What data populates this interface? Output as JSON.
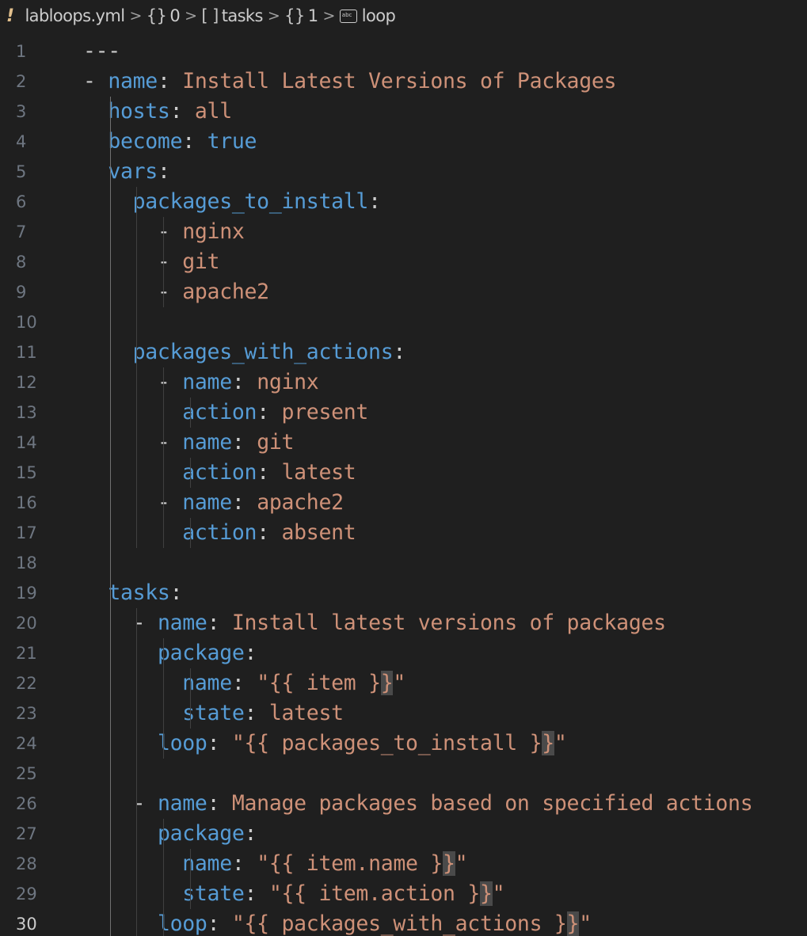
{
  "breadcrumb": {
    "warning_icon": "exclamation-icon",
    "file": "labloops.yml",
    "sep": ">",
    "segments": [
      {
        "icon": "object-icon",
        "symbol": "{}",
        "label": "0"
      },
      {
        "icon": "array-icon",
        "symbol": "[ ]",
        "label": "tasks"
      },
      {
        "icon": "object-icon",
        "symbol": "{}",
        "label": "1"
      },
      {
        "icon": "string-icon",
        "symbol": "",
        "label": "loop"
      }
    ]
  },
  "colors": {
    "background": "#1f1f1f",
    "key": "#569cd6",
    "value": "#ce9178",
    "line_number": "#6e7681"
  },
  "active_line": 30,
  "lines": [
    {
      "n": "1",
      "t": [
        {
          "c": "p",
          "s": "---"
        }
      ]
    },
    {
      "n": "2",
      "t": [
        {
          "c": "p",
          "s": "- "
        },
        {
          "c": "k",
          "s": "name"
        },
        {
          "c": "p",
          "s": ": "
        },
        {
          "c": "v",
          "s": "Install Latest Versions of Packages"
        }
      ]
    },
    {
      "n": "3",
      "t": [
        {
          "c": "p",
          "s": "  "
        },
        {
          "c": "k",
          "s": "hosts"
        },
        {
          "c": "p",
          "s": ": "
        },
        {
          "c": "v",
          "s": "all"
        }
      ]
    },
    {
      "n": "4",
      "t": [
        {
          "c": "p",
          "s": "  "
        },
        {
          "c": "k",
          "s": "become"
        },
        {
          "c": "p",
          "s": ": "
        },
        {
          "c": "k",
          "s": "true"
        }
      ]
    },
    {
      "n": "5",
      "t": [
        {
          "c": "p",
          "s": "  "
        },
        {
          "c": "k",
          "s": "vars"
        },
        {
          "c": "p",
          "s": ":"
        }
      ]
    },
    {
      "n": "6",
      "t": [
        {
          "c": "p",
          "s": "    "
        },
        {
          "c": "k",
          "s": "packages_to_install"
        },
        {
          "c": "p",
          "s": ":"
        }
      ]
    },
    {
      "n": "7",
      "t": [
        {
          "c": "p",
          "s": "      - "
        },
        {
          "c": "v",
          "s": "nginx"
        }
      ]
    },
    {
      "n": "8",
      "t": [
        {
          "c": "p",
          "s": "      - "
        },
        {
          "c": "v",
          "s": "git"
        }
      ]
    },
    {
      "n": "9",
      "t": [
        {
          "c": "p",
          "s": "      - "
        },
        {
          "c": "v",
          "s": "apache2"
        }
      ]
    },
    {
      "n": "10",
      "t": []
    },
    {
      "n": "11",
      "t": [
        {
          "c": "p",
          "s": "    "
        },
        {
          "c": "k",
          "s": "packages_with_actions"
        },
        {
          "c": "p",
          "s": ":"
        }
      ]
    },
    {
      "n": "12",
      "t": [
        {
          "c": "p",
          "s": "      - "
        },
        {
          "c": "k",
          "s": "name"
        },
        {
          "c": "p",
          "s": ": "
        },
        {
          "c": "v",
          "s": "nginx"
        }
      ]
    },
    {
      "n": "13",
      "t": [
        {
          "c": "p",
          "s": "        "
        },
        {
          "c": "k",
          "s": "action"
        },
        {
          "c": "p",
          "s": ": "
        },
        {
          "c": "v",
          "s": "present"
        }
      ]
    },
    {
      "n": "14",
      "t": [
        {
          "c": "p",
          "s": "      - "
        },
        {
          "c": "k",
          "s": "name"
        },
        {
          "c": "p",
          "s": ": "
        },
        {
          "c": "v",
          "s": "git"
        }
      ]
    },
    {
      "n": "15",
      "t": [
        {
          "c": "p",
          "s": "        "
        },
        {
          "c": "k",
          "s": "action"
        },
        {
          "c": "p",
          "s": ": "
        },
        {
          "c": "v",
          "s": "latest"
        }
      ]
    },
    {
      "n": "16",
      "t": [
        {
          "c": "p",
          "s": "      - "
        },
        {
          "c": "k",
          "s": "name"
        },
        {
          "c": "p",
          "s": ": "
        },
        {
          "c": "v",
          "s": "apache2"
        }
      ]
    },
    {
      "n": "17",
      "t": [
        {
          "c": "p",
          "s": "        "
        },
        {
          "c": "k",
          "s": "action"
        },
        {
          "c": "p",
          "s": ": "
        },
        {
          "c": "v",
          "s": "absent"
        }
      ]
    },
    {
      "n": "18",
      "t": []
    },
    {
      "n": "19",
      "t": [
        {
          "c": "p",
          "s": "  "
        },
        {
          "c": "k",
          "s": "tasks"
        },
        {
          "c": "p",
          "s": ":"
        }
      ]
    },
    {
      "n": "20",
      "t": [
        {
          "c": "p",
          "s": "    - "
        },
        {
          "c": "k",
          "s": "name"
        },
        {
          "c": "p",
          "s": ": "
        },
        {
          "c": "v",
          "s": "Install latest versions of packages"
        }
      ]
    },
    {
      "n": "21",
      "t": [
        {
          "c": "p",
          "s": "      "
        },
        {
          "c": "k",
          "s": "package"
        },
        {
          "c": "p",
          "s": ":"
        }
      ]
    },
    {
      "n": "22",
      "t": [
        {
          "c": "p",
          "s": "        "
        },
        {
          "c": "k",
          "s": "name"
        },
        {
          "c": "p",
          "s": ": "
        },
        {
          "c": "v",
          "s": "\"{{ item }"
        },
        {
          "c": "br",
          "s": "}"
        },
        {
          "c": "v",
          "s": "\""
        }
      ]
    },
    {
      "n": "23",
      "t": [
        {
          "c": "p",
          "s": "        "
        },
        {
          "c": "k",
          "s": "state"
        },
        {
          "c": "p",
          "s": ": "
        },
        {
          "c": "v",
          "s": "latest"
        }
      ]
    },
    {
      "n": "24",
      "t": [
        {
          "c": "p",
          "s": "      "
        },
        {
          "c": "k",
          "s": "loop"
        },
        {
          "c": "p",
          "s": ": "
        },
        {
          "c": "v",
          "s": "\"{{ packages_to_install }"
        },
        {
          "c": "br",
          "s": "}"
        },
        {
          "c": "v",
          "s": "\""
        }
      ]
    },
    {
      "n": "25",
      "t": []
    },
    {
      "n": "26",
      "t": [
        {
          "c": "p",
          "s": "    - "
        },
        {
          "c": "k",
          "s": "name"
        },
        {
          "c": "p",
          "s": ": "
        },
        {
          "c": "v",
          "s": "Manage packages based on specified actions"
        }
      ]
    },
    {
      "n": "27",
      "t": [
        {
          "c": "p",
          "s": "      "
        },
        {
          "c": "k",
          "s": "package"
        },
        {
          "c": "p",
          "s": ":"
        }
      ]
    },
    {
      "n": "28",
      "t": [
        {
          "c": "p",
          "s": "        "
        },
        {
          "c": "k",
          "s": "name"
        },
        {
          "c": "p",
          "s": ": "
        },
        {
          "c": "v",
          "s": "\"{{ item.name }"
        },
        {
          "c": "br",
          "s": "}"
        },
        {
          "c": "v",
          "s": "\""
        }
      ]
    },
    {
      "n": "29",
      "t": [
        {
          "c": "p",
          "s": "        "
        },
        {
          "c": "k",
          "s": "state"
        },
        {
          "c": "p",
          "s": ": "
        },
        {
          "c": "v",
          "s": "\"{{ item.action }"
        },
        {
          "c": "br",
          "s": "}"
        },
        {
          "c": "v",
          "s": "\""
        }
      ]
    },
    {
      "n": "30",
      "t": [
        {
          "c": "p",
          "s": "      "
        },
        {
          "c": "k",
          "s": "loop"
        },
        {
          "c": "p",
          "s": ": "
        },
        {
          "c": "v",
          "s": "\"{{ packages_with_actions }"
        },
        {
          "c": "br",
          "s": "}"
        },
        {
          "c": "v",
          "s": "\""
        }
      ]
    }
  ]
}
